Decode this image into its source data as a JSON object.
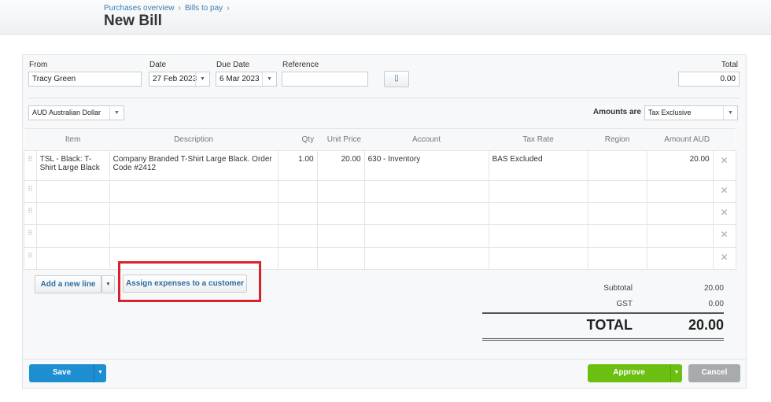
{
  "breadcrumb": [
    "Purchases overview",
    "Bills to pay"
  ],
  "breadcrumb_sep": "›",
  "page_title": "New Bill",
  "form": {
    "from_label": "From",
    "from_value": "Tracy Green",
    "date_label": "Date",
    "date_value": "27 Feb 2023",
    "due_label": "Due Date",
    "due_value": "6 Mar 2023",
    "reference_label": "Reference",
    "reference_value": "",
    "total_label": "Total",
    "total_value": "0.00",
    "currency": "AUD Australian Dollar",
    "amounts_are_label": "Amounts are",
    "amounts_are_value": "Tax Exclusive"
  },
  "table": {
    "columns": [
      "Item",
      "Description",
      "Qty",
      "Unit Price",
      "Account",
      "Tax Rate",
      "Region",
      "Amount AUD"
    ],
    "rows": [
      [
        "TSL - Black: T-Shirt Large Black",
        "Company Branded T-Shirt Large Black. Order Code #2412",
        "1.00",
        "20.00",
        "630 - Inventory",
        "BAS Excluded",
        "",
        "20.00"
      ],
      [
        "",
        "",
        "",
        "",
        "",
        "",
        "",
        ""
      ],
      [
        "",
        "",
        "",
        "",
        "",
        "",
        "",
        ""
      ],
      [
        "",
        "",
        "",
        "",
        "",
        "",
        "",
        ""
      ],
      [
        "",
        "",
        "",
        "",
        "",
        "",
        "",
        ""
      ]
    ]
  },
  "buttons": {
    "add_line": "Add a new line",
    "assign": "Assign expenses to a customer",
    "save": "Save",
    "approve": "Approve",
    "cancel": "Cancel"
  },
  "summary": {
    "subtotal_label": "Subtotal",
    "subtotal": "20.00",
    "gst_label": "GST",
    "gst": "0.00",
    "total_label": "TOTAL",
    "total": "20.00"
  },
  "colors": {
    "save": "#1d8fd0",
    "approve": "#6cbf10",
    "cancel": "#a8abae",
    "highlight": "#d9232a"
  }
}
